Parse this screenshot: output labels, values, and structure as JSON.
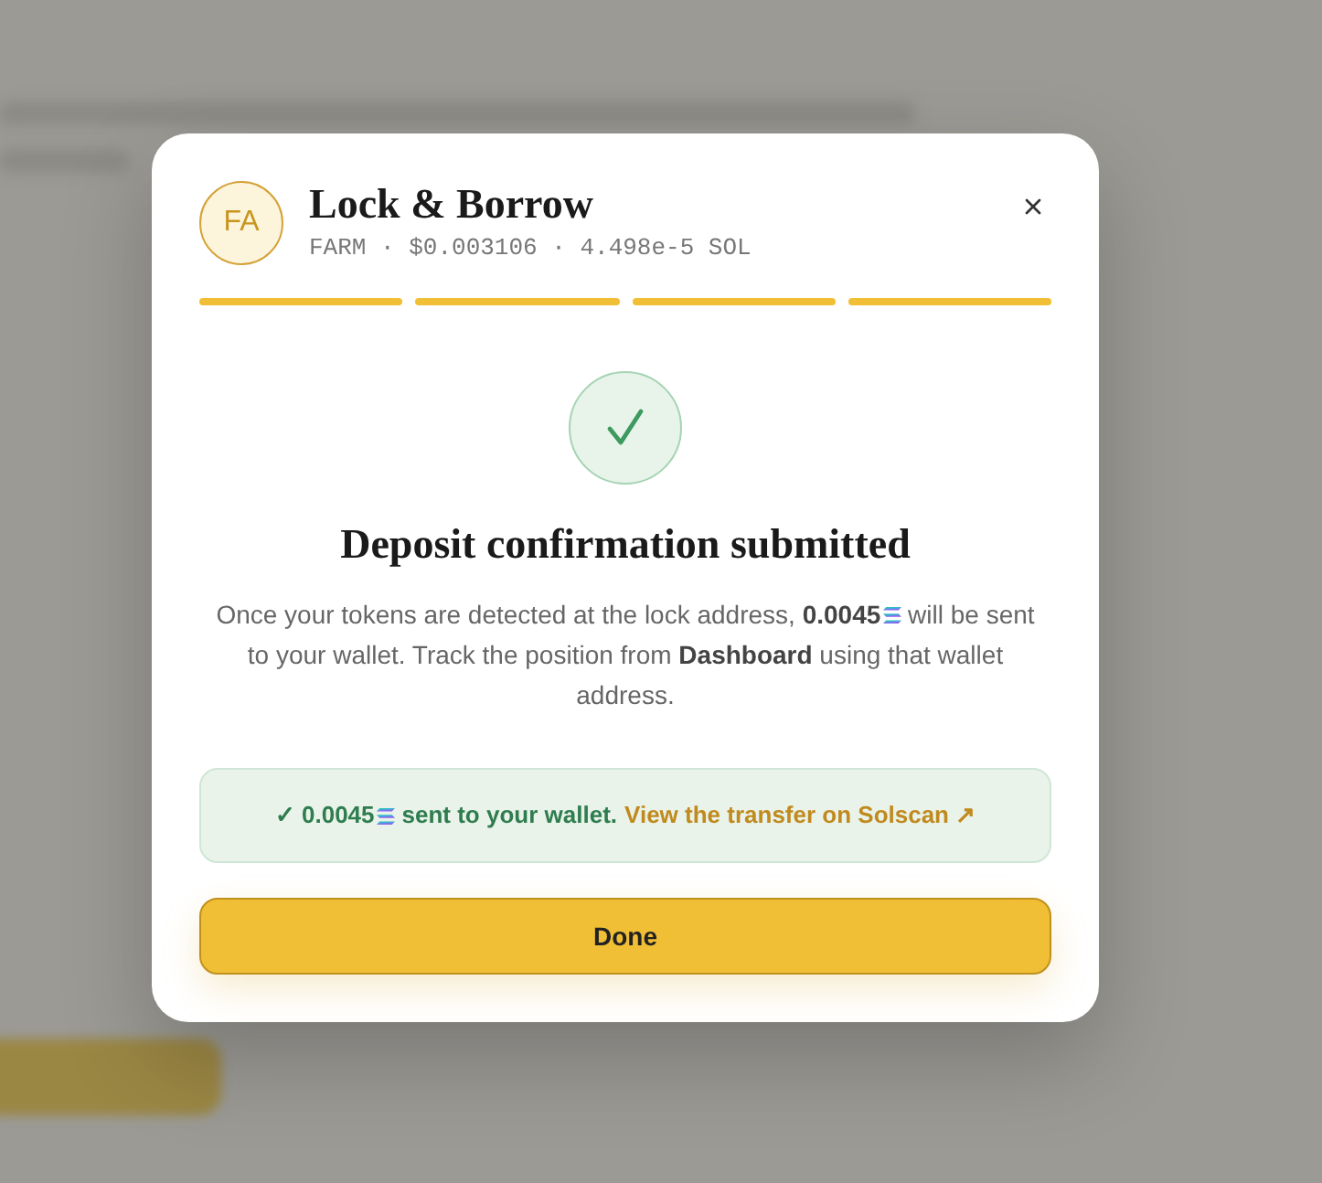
{
  "dialog": {
    "avatar": "FA",
    "title": "Lock & Borrow",
    "subtitle": "FARM · $0.003106 · 4.498e-5 SOL",
    "steps": [
      {
        "completed": true
      },
      {
        "completed": true
      },
      {
        "completed": true
      },
      {
        "completed": true
      }
    ]
  },
  "status": {
    "heading": "Deposit confirmation submitted",
    "message_before_token": "Once your tokens are detected at the lock address, **0.0045**",
    "message_after_token": " will be sent to your wallet. Track the position from **Dashboard** using that wallet address."
  },
  "banner": {
    "amount": "✓ 0.0045",
    "text": "sent to your wallet.",
    "link": "View the transfer on Solscan ↗"
  },
  "done_button": {
    "label": "Done"
  }
}
